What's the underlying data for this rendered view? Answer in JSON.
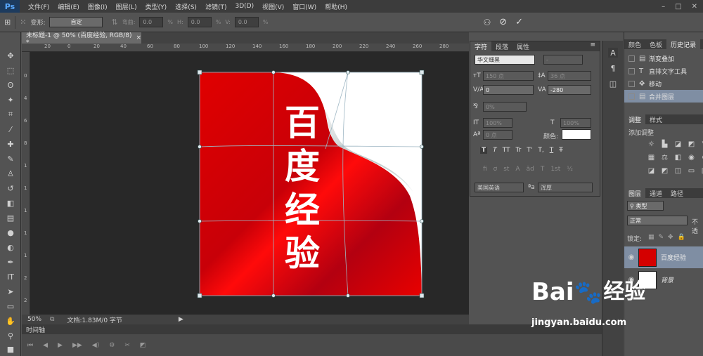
{
  "app": {
    "logo": "Ps"
  },
  "menu": [
    "文件(F)",
    "编辑(E)",
    "图像(I)",
    "图层(L)",
    "类型(Y)",
    "选择(S)",
    "滤镜(T)",
    "3D(D)",
    "视图(V)",
    "窗口(W)",
    "帮助(H)"
  ],
  "options": {
    "transform_label": "变形:",
    "transform_value": "自定",
    "bend_label": "弯曲:",
    "bend_value": "0.0",
    "bend_unit": "%",
    "h_label": "H:",
    "h_value": "0.0",
    "h_unit": "%",
    "v_label": "V:",
    "v_value": "0.0",
    "v_unit": "%"
  },
  "document": {
    "tab_title": "未标题-1 @ 50% (百度经验, RGB/8) *",
    "zoom": "50%",
    "doc_info": "文档:1.83M/0 字节",
    "ruler_top": [
      "20",
      "0",
      "20",
      "40",
      "60",
      "80",
      "100",
      "120",
      "140",
      "160",
      "180",
      "200",
      "220",
      "240",
      "260",
      "280"
    ],
    "ruler_left": [
      "0",
      "4",
      "6",
      "8",
      "1",
      "1",
      "1",
      "1",
      "1",
      "2",
      "2"
    ]
  },
  "canvas_text": [
    "百",
    "度",
    "经",
    "验"
  ],
  "colors": {
    "red": "#d40000",
    "page": "#ffffff",
    "workspace": "#282828",
    "panel": "#535353"
  },
  "character_panel": {
    "tabs": [
      "字符",
      "段落",
      "属性"
    ],
    "font_family": "华文细黑",
    "font_style": "-",
    "size": "150 点",
    "leading": "36 点",
    "kerning": "0",
    "tracking": "-280",
    "scale_pct": "0%",
    "vscale": "100%",
    "hscale": "100%",
    "baseline": "0 点",
    "color_label": "颜色:",
    "language": "美国英语",
    "aa_label": "ªa",
    "antialias": "浑厚",
    "style_buttons": [
      "T",
      "T",
      "TT",
      "Tr",
      "T'",
      "T,",
      "T",
      "T"
    ],
    "opentype_buttons": [
      "fi",
      "ơ",
      "st",
      "A",
      "ād",
      "T",
      "1st",
      "½"
    ]
  },
  "history_panel": {
    "tabs": [
      "颜色",
      "色板",
      "历史记录"
    ],
    "items": [
      "渐变叠加",
      "直排文字工具",
      "移动",
      "合并图层"
    ]
  },
  "adjust_panel": {
    "tabs": [
      "调整",
      "样式"
    ],
    "add_label": "添加调整"
  },
  "layers_panel": {
    "tabs": [
      "图层",
      "通道",
      "路径"
    ],
    "filter_label": "类型",
    "blend_mode": "正常",
    "opacity_label": "不透",
    "lock_label": "锁定:",
    "layers": [
      {
        "name": "百度经验",
        "selected": true
      },
      {
        "name": "背景",
        "selected": false
      }
    ]
  },
  "timeline": {
    "tab": "时间轴"
  },
  "watermark": {
    "brand": "Bai",
    "brand2": "经验",
    "url": "jingyan.baidu.com"
  }
}
